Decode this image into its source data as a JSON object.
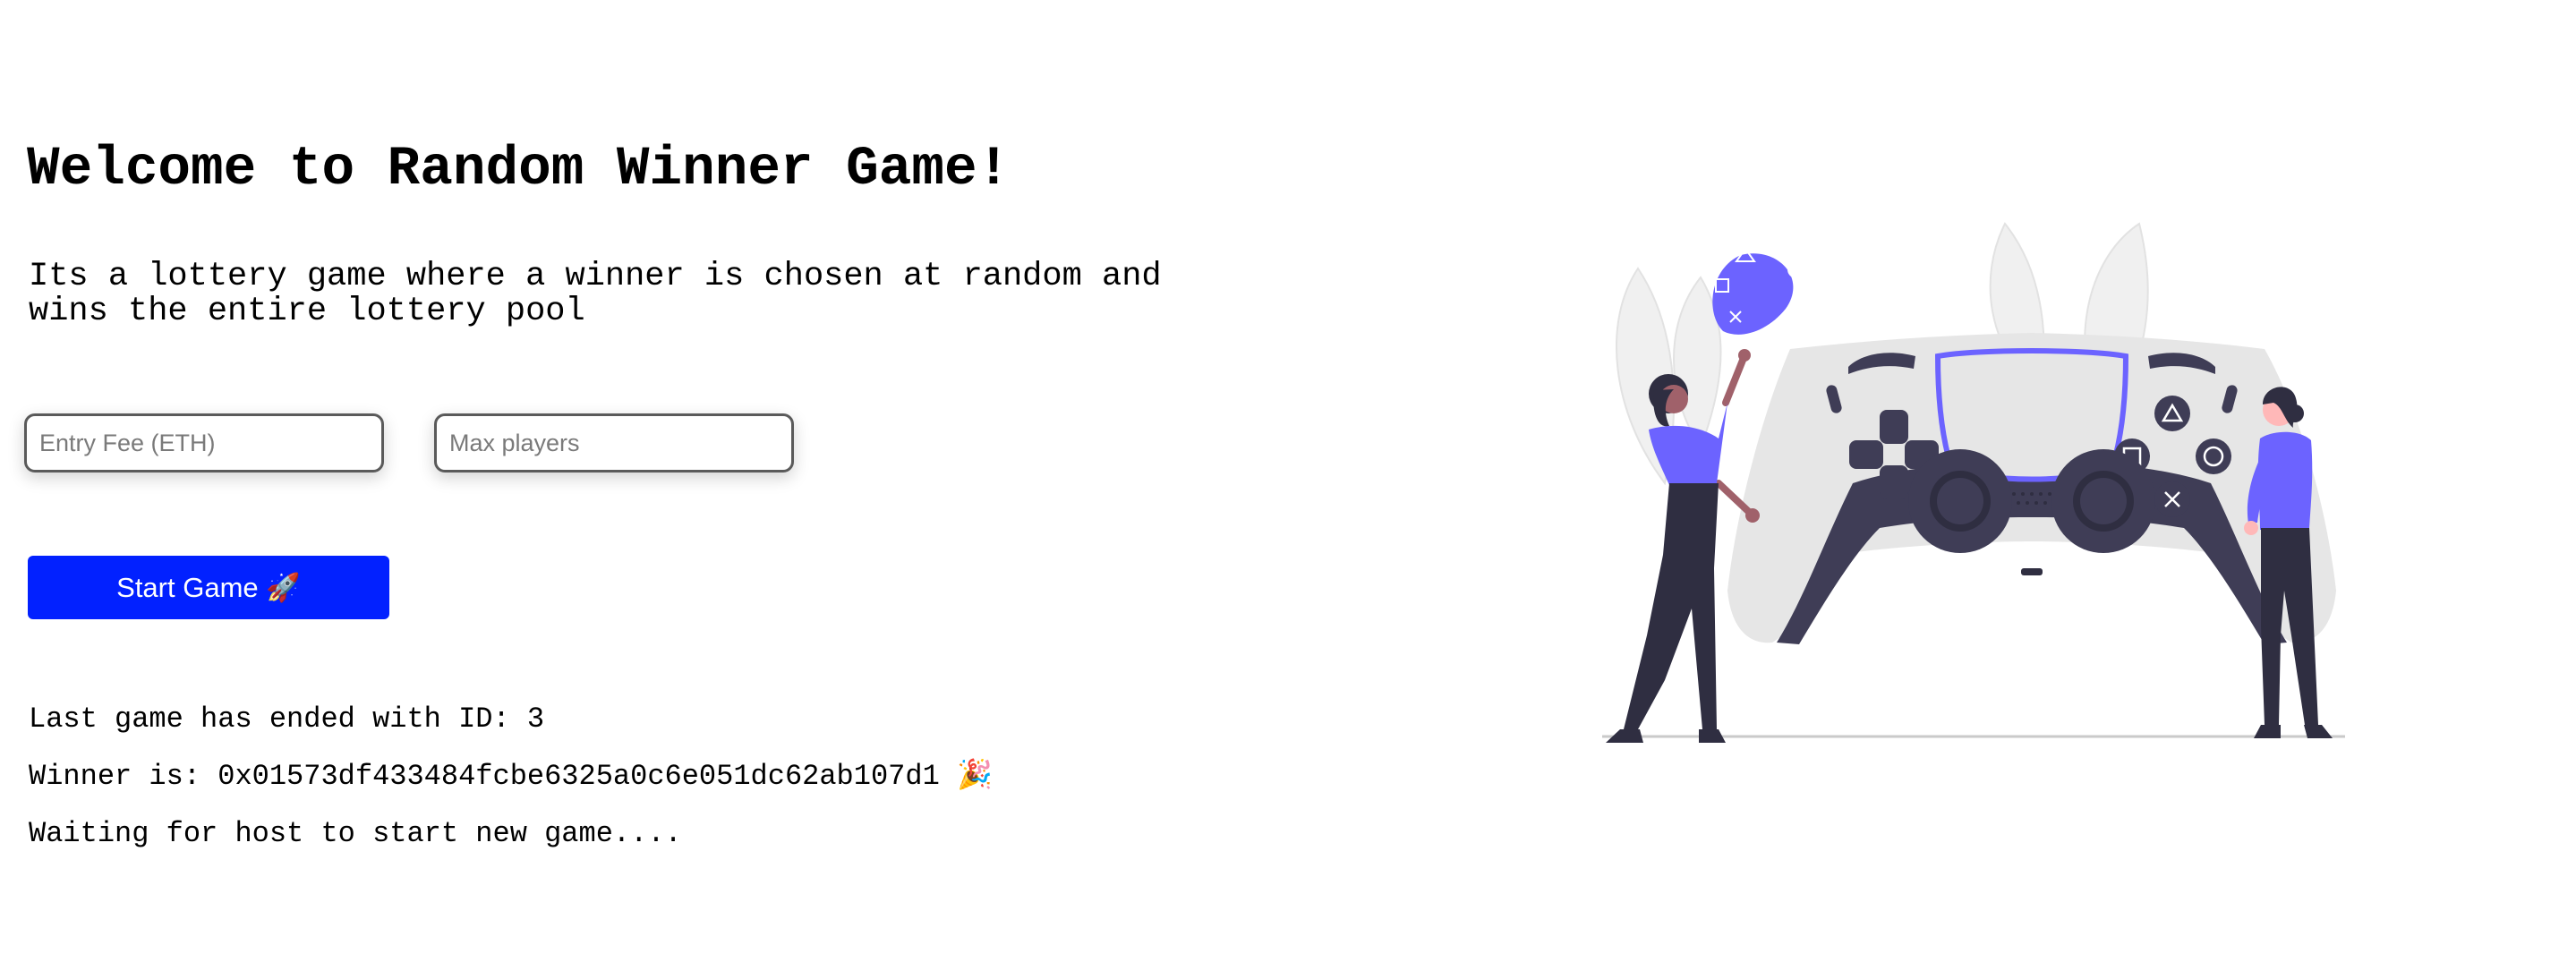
{
  "header": {
    "title": "Welcome to Random Winner Game!",
    "description": "Its a lottery game where a winner is chosen at random and wins the entire lottery pool"
  },
  "form": {
    "entry_fee_placeholder": "Entry Fee (ETH)",
    "entry_fee_value": "",
    "max_players_placeholder": "Max players",
    "max_players_value": "",
    "start_button_label": "Start Game 🚀"
  },
  "status": {
    "last_game": "Last game has ended with ID: 3",
    "winner": "Winner is: 0x01573df433484fcbe6325a0c6e051dc62ab107d1 🎉",
    "waiting": "Waiting for host to start new game...."
  },
  "illustration": {
    "icon": "game-controller-illustration",
    "colors": {
      "accent": "#6c63ff",
      "dark": "#3f3d56",
      "light": "#e6e6e6",
      "skin": "#a0616a",
      "skin_light": "#ffb8b8"
    }
  },
  "colors": {
    "button": "#0221ff",
    "text": "#000000"
  }
}
